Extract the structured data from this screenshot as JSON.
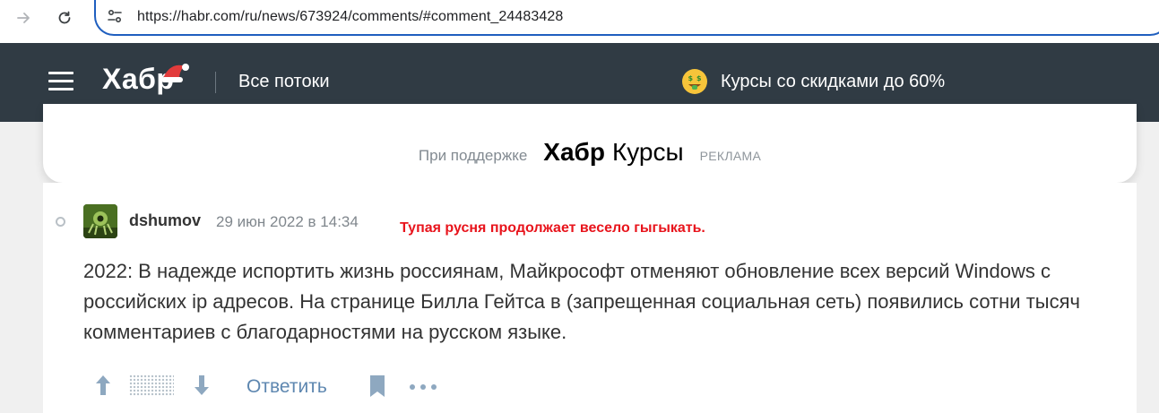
{
  "browser": {
    "url": "https://habr.com/ru/news/673924/comments/#comment_24483428",
    "icons": [
      "arrow-forward-icon",
      "reload-icon",
      "site-settings-icon"
    ]
  },
  "header": {
    "logo": "Хабр",
    "streams_label": "Все потоки",
    "promo_text": "Курсы со скидками до 60%",
    "icons": [
      "hamburger-menu-icon",
      "santa-hat-icon",
      "money-face-emoji"
    ],
    "colors": {
      "background": "#303b44",
      "text": "#ffffff"
    }
  },
  "sponsor": {
    "support_label": "При поддержке",
    "brand": "Хабр",
    "brand_suffix": "Курсы",
    "ad_label": "РЕКЛАМА"
  },
  "comment": {
    "author": "dshumov",
    "date": "29 июн 2022 в 14:34",
    "overlay_note": "Тупая русня продолжает весело гыгыкать.",
    "text": "2022: В надежде испортить жизнь россиянам, Майкрософт отменяют обновление всех версий Windows с российских ip адресов. На странице Билла Гейтса в (запрещенная социальная сеть) появились сотни тысяч комментариев с благодарностями на русском языке.",
    "reply_label": "Ответить",
    "icons": [
      "thread-dot-icon",
      "vote-up-icon",
      "vote-down-icon",
      "bookmark-icon",
      "more-icon"
    ],
    "colors": {
      "overlay_note": "#e8141c",
      "link": "#5e87b0",
      "action_icon": "#8ea8c0"
    }
  }
}
